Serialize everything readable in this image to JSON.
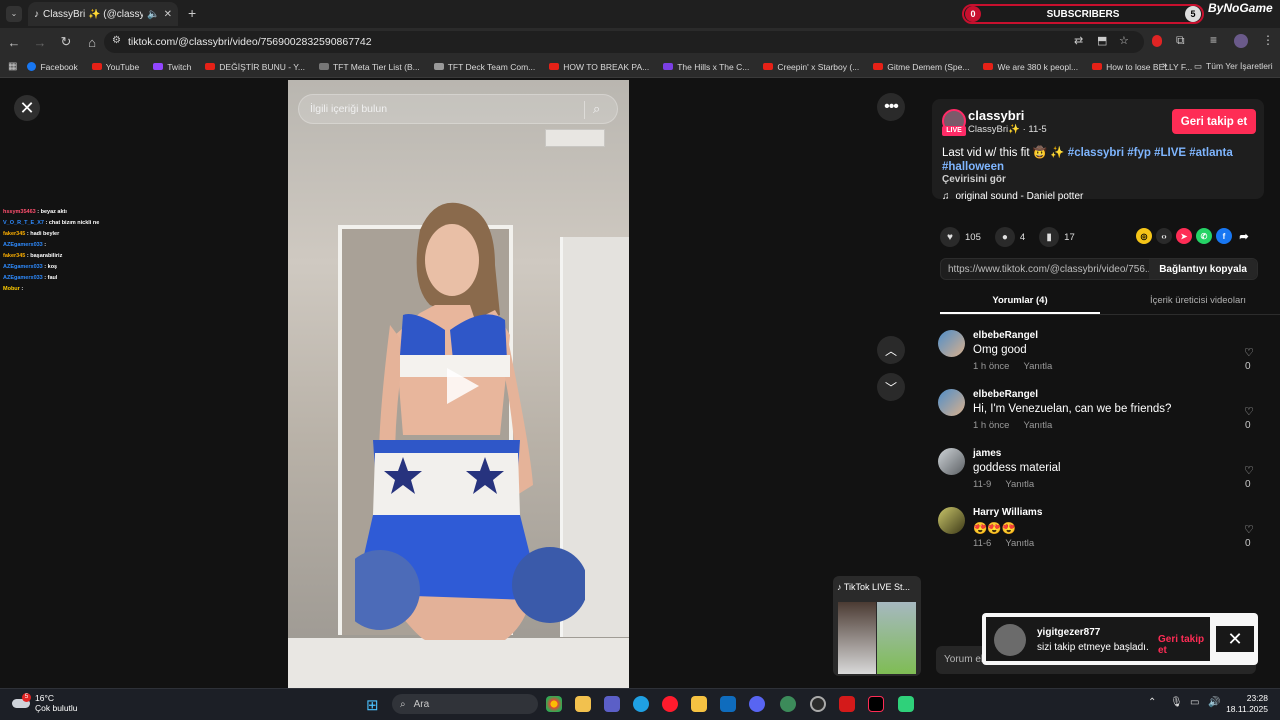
{
  "browser": {
    "tab_title": "ClassyBri ✨ (@classybri) | T",
    "new_tab": "+",
    "url": "tiktok.com/@classybri/video/7569002832590867742",
    "bookmarks": [
      "Facebook",
      "YouTube",
      "Twitch",
      "DEĞİŞTİR BUNU - Y...",
      "TFT Meta Tier List (B...",
      "TFT Deck Team Com...",
      "HOW TO BREAK PA...",
      "The Hills x The C...",
      "Creepin' x Starboy (...",
      "Gitme Demem (Spe...",
      "We are 380 k peopl...",
      "How to lose BELLY F..."
    ],
    "all_bookmarks": "Tüm Yer İşaretleri"
  },
  "overlay": {
    "subs_count": "0",
    "subs_label": "SUBSCRIBERS",
    "subs_goal": "5",
    "brand": "ByNoGame"
  },
  "chat": [
    {
      "user": "hssym35463",
      "msg": "beyaz aktı",
      "color": "#ff4f6e"
    },
    {
      "user": "V_O_R_T_E_X7",
      "msg": "chat bizım nickli ne",
      "color": "#2e8bff"
    },
    {
      "user": "faker345",
      "msg": "hadi beyler",
      "color": "#ffb000"
    },
    {
      "user": "AZEgamerx033",
      "msg": "",
      "color": "#2e8bff"
    },
    {
      "user": "faker345",
      "msg": "başarabiliriz",
      "color": "#ffb000"
    },
    {
      "user": "AZEgamerx033",
      "msg": "koş",
      "color": "#2e8bff"
    },
    {
      "user": "AZEgamerx033",
      "msg": "faul",
      "color": "#2e8bff"
    },
    {
      "user": "Mobur",
      "msg": "",
      "color": "#ffcc00"
    }
  ],
  "video": {
    "search_placeholder": "İlgili içeriği bulun"
  },
  "author": {
    "username": "classybri",
    "display": "ClassyBri✨ · 11-5",
    "live_badge": "LIVE",
    "follow_button": "Geri takip et",
    "caption": "Last vid w/ this fit 🤠 ✨",
    "hashtags": "#classybri #fyp #LIVE #atlanta",
    "hashtags2": "#halloween",
    "translate": "Çevirisini gör",
    "sound": "original sound - Daniel potter"
  },
  "stats": {
    "likes": "105",
    "comments": "4",
    "saves": "17"
  },
  "link": {
    "url": "https://www.tiktok.com/@classybri/video/756...",
    "copy_button": "Bağlantıyı kopyala"
  },
  "tabs": {
    "comments": "Yorumlar (4)",
    "creator_videos": "İçerik üreticisi videoları"
  },
  "comments": [
    {
      "name": "elbebeRangel",
      "text": "Omg good",
      "time": "1 h önce",
      "reply": "Yanıtla",
      "likes": "0"
    },
    {
      "name": "elbebeRangel",
      "text": "Hi, I'm Venezuelan, can we be friends?",
      "time": "1 h önce",
      "reply": "Yanıtla",
      "likes": "0"
    },
    {
      "name": "james",
      "text": "goddess material",
      "time": "11-9",
      "reply": "Yanıtla",
      "likes": "0"
    },
    {
      "name": "Harry Williams",
      "text": "😍😍😍",
      "time": "11-6",
      "reply": "Yanıtla",
      "likes": "0"
    }
  ],
  "pip": {
    "title": "TikTok LIVE St..."
  },
  "comment_input": {
    "placeholder": "Yorum ekle..."
  },
  "toast": {
    "user": "yigitgezer877",
    "message": "sizi takip etmeye başladı.",
    "button": "Geri takip et"
  },
  "taskbar": {
    "temp": "16°C",
    "weather": "Çok bulutlu",
    "weather_badge": "5",
    "search": "Ara",
    "time": "23:28",
    "date": "18.11.2025"
  }
}
